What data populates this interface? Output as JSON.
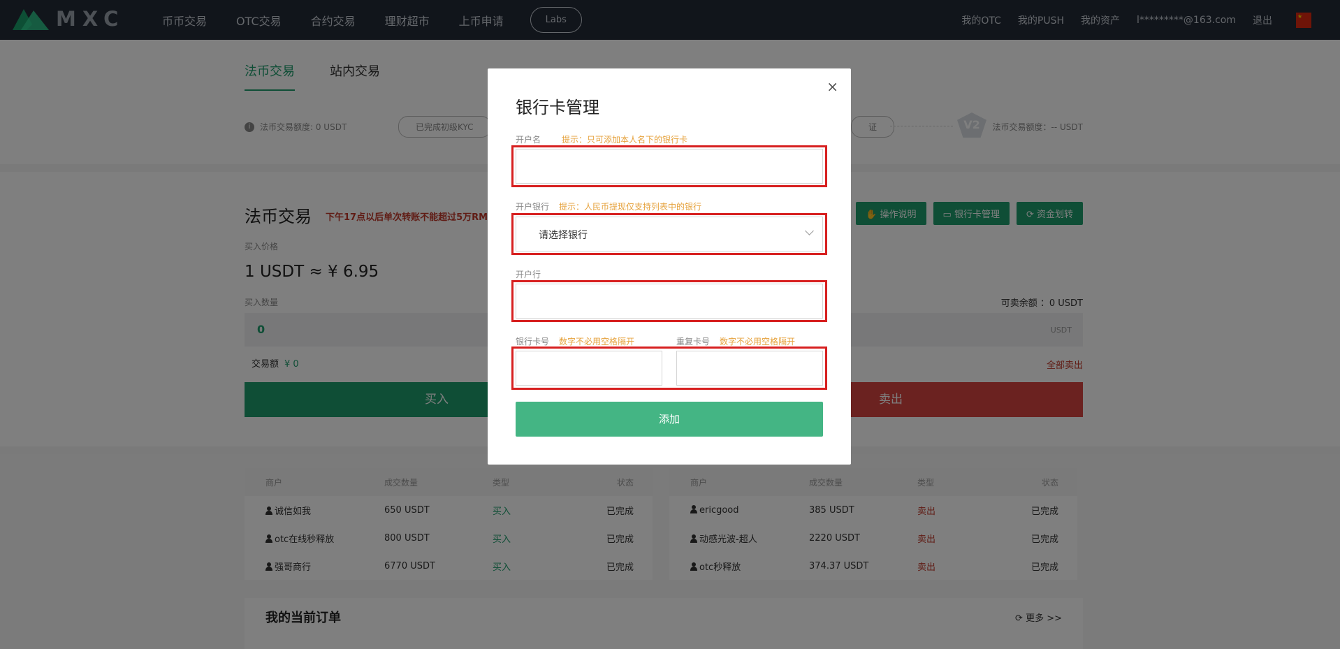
{
  "nav": {
    "logo_text": "MXC",
    "items": [
      "币币交易",
      "OTC交易",
      "合约交易",
      "理财超市",
      "上币申请"
    ],
    "labs": "Labs",
    "right": [
      "我的OTC",
      "我的PUSH",
      "我的资产",
      "l*********@163.com",
      "退出"
    ]
  },
  "tabs": [
    "法币交易",
    "站内交易"
  ],
  "limits": {
    "left": "法币交易额度: 0 USDT",
    "kyc_done": "已完成初级KYC",
    "kyc_next": "证",
    "level": "V2",
    "right": "法币交易额度：-- USDT"
  },
  "fiat": {
    "title": "法币交易",
    "warning": "下午17点以后单次转账不能超过5万RM",
    "tools": [
      "操作说明",
      "银行卡管理",
      "资金划转"
    ],
    "buy_price_label": "买入价格",
    "price": "1 USDT ≈ ¥ 6.95",
    "qty_label": "买入数量",
    "available": "可卖余额 ：0 USDT",
    "qty_value": "0",
    "qty_unit": "USDT",
    "amount_label": "交易额",
    "amount_value": "¥ 0",
    "sell_all": "全部卖出",
    "buy": "买入",
    "sell": "卖出"
  },
  "tables": {
    "headers": [
      "商户",
      "成交数量",
      "类型",
      "状态"
    ],
    "left_rows": [
      {
        "merchant": "诚信如我",
        "qty": "650 USDT",
        "type": "买入",
        "status": "已完成"
      },
      {
        "merchant": "otc在线秒释放",
        "qty": "800 USDT",
        "type": "买入",
        "status": "已完成"
      },
      {
        "merchant": "强哥商行",
        "qty": "6770 USDT",
        "type": "买入",
        "status": "已完成"
      }
    ],
    "right_rows": [
      {
        "merchant": "ericgood",
        "qty": "385 USDT",
        "type": "卖出",
        "status": "已完成"
      },
      {
        "merchant": "动感光波-超人",
        "qty": "2220 USDT",
        "type": "卖出",
        "status": "已完成"
      },
      {
        "merchant": "otc秒释放",
        "qty": "374.37 USDT",
        "type": "卖出",
        "status": "已完成"
      }
    ]
  },
  "orders": {
    "title": "我的当前订单",
    "more": "更多 >>"
  },
  "modal": {
    "title": "银行卡管理",
    "name_label": "开户名",
    "name_hint": "提示：只可添加本人名下的银行卡",
    "bank_label": "开户银行",
    "bank_hint": "提示：人民币提现仅支持列表中的银行",
    "bank_placeholder": "请选择银行",
    "branch_label": "开户行",
    "card_label": "银行卡号",
    "card_hint": "数字不必用空格隔开",
    "card2_label": "重复卡号",
    "card2_hint": "数字不必用空格隔开",
    "add": "添加",
    "close": "×"
  },
  "colors": {
    "accent_green": "#1f9d6d",
    "sell_red": "#d64540",
    "highlight_red": "#d72020",
    "hint_orange": "#e6a23c"
  }
}
